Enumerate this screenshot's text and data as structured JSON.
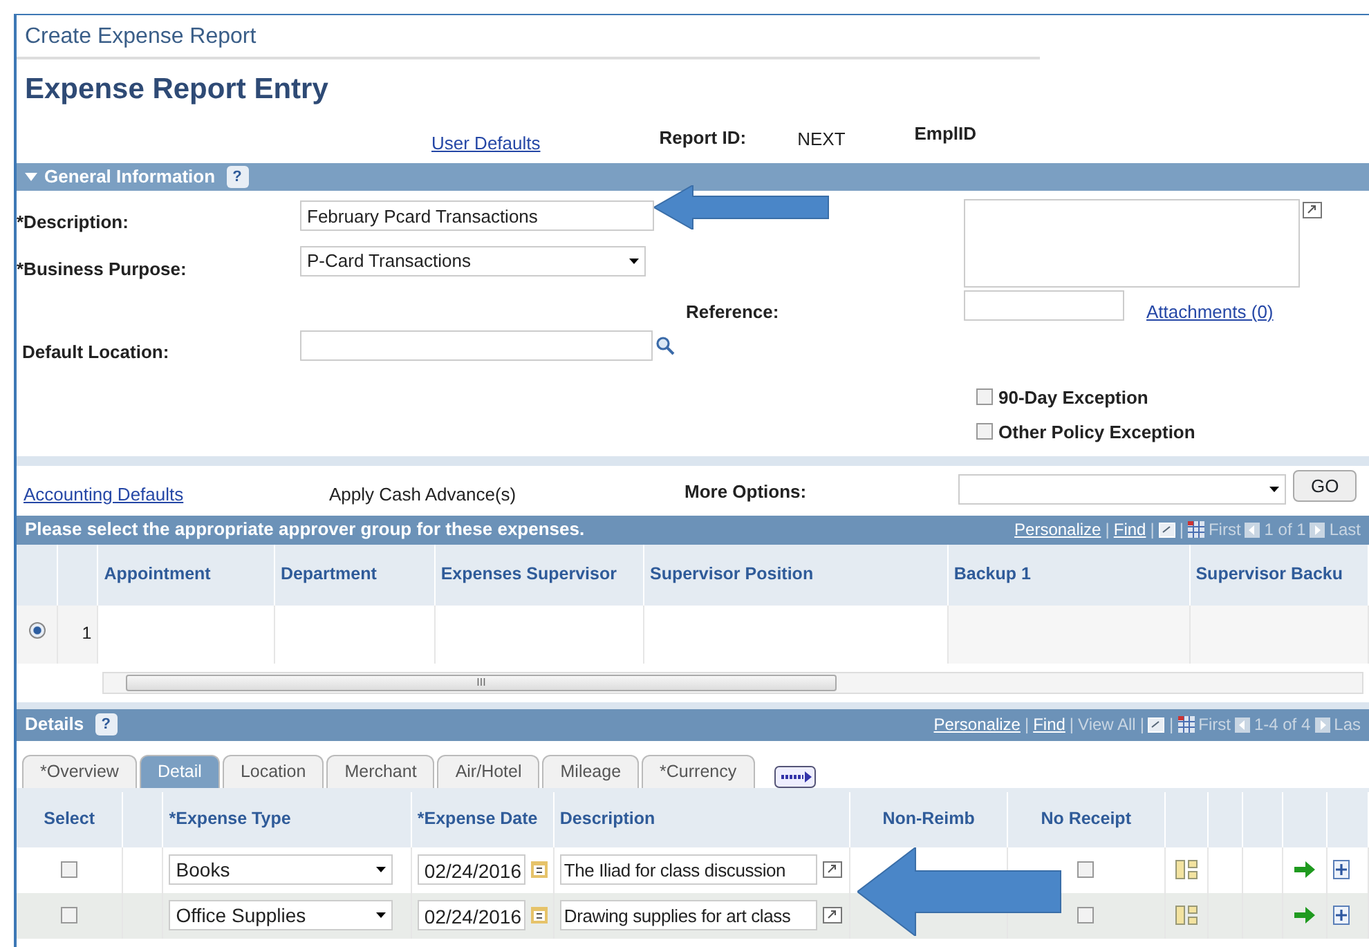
{
  "breadcrumb": "Create Expense Report",
  "title": "Expense Report Entry",
  "header": {
    "user_defaults": "User Defaults",
    "report_id_label": "Report ID:",
    "report_id": "NEXT",
    "emplid_label": "EmplID"
  },
  "general": {
    "title": "General Information",
    "help": "?",
    "expanded": true,
    "description": {
      "label": "*Description:",
      "value": "February Pcard Transactions"
    },
    "business_purpose": {
      "label": "*Business Purpose:",
      "value": "P-Card Transactions"
    },
    "reference_label": "Reference:",
    "attachments": "Attachments (0)",
    "default_location_label": "Default Location:",
    "checkboxes": [
      {
        "label": "90-Day Exception",
        "checked": false
      },
      {
        "label": "Other Policy Exception",
        "checked": false
      }
    ]
  },
  "options_bar": {
    "accounting_defaults": "Accounting Defaults",
    "apply_cash": "Apply Cash Advance(s)",
    "more_options_label": "More Options:",
    "go": "GO"
  },
  "approver_grid": {
    "title": "Please select the appropriate approver group for these expenses.",
    "nav": [
      {
        "kind": "link",
        "text": "Personalize"
      },
      {
        "kind": "sep",
        "text": "|"
      },
      {
        "kind": "link",
        "text": "Find"
      },
      {
        "kind": "sep",
        "text": "|"
      },
      {
        "kind": "zoom"
      },
      {
        "kind": "sep",
        "text": "|"
      },
      {
        "kind": "grid"
      },
      {
        "kind": "text",
        "text": "First"
      },
      {
        "kind": "prev"
      },
      {
        "kind": "count",
        "text": "1 of 1"
      },
      {
        "kind": "next"
      },
      {
        "kind": "text",
        "text": "Last"
      }
    ],
    "columns": [
      "Appointment",
      "Department",
      "Expenses Supervisor",
      "Supervisor Position",
      "Backup 1",
      "Supervisor Backu"
    ],
    "rows": [
      {
        "selected": true,
        "number": "1"
      }
    ],
    "scroll_mark": "III"
  },
  "details": {
    "title": "Details",
    "help": "?",
    "nav": [
      {
        "kind": "link",
        "text": "Personalize"
      },
      {
        "kind": "sep",
        "text": "|"
      },
      {
        "kind": "link",
        "text": "Find"
      },
      {
        "kind": "sep",
        "text": "|"
      },
      {
        "kind": "text",
        "text": "View All"
      },
      {
        "kind": "sep",
        "text": "|"
      },
      {
        "kind": "zoom"
      },
      {
        "kind": "sep",
        "text": "|"
      },
      {
        "kind": "grid"
      },
      {
        "kind": "text",
        "text": "First"
      },
      {
        "kind": "prev"
      },
      {
        "kind": "count",
        "text": "1-4 of 4"
      },
      {
        "kind": "next"
      },
      {
        "kind": "text",
        "text": "Las"
      }
    ],
    "tabs": [
      {
        "label": "*Overview",
        "selected": false
      },
      {
        "label": "Detail",
        "selected": true
      },
      {
        "label": "Location",
        "selected": false
      },
      {
        "label": "Merchant",
        "selected": false
      },
      {
        "label": "Air/Hotel",
        "selected": false
      },
      {
        "label": "Mileage",
        "selected": false
      },
      {
        "label": "*Currency",
        "selected": false
      }
    ],
    "columns": [
      "Select",
      "*Expense Type",
      "*Expense Date",
      "Description",
      "Non-Reimb",
      "No Receipt"
    ],
    "rows": [
      {
        "checked": false,
        "expense_type": "Books",
        "date": "02/24/2016",
        "description": "The Iliad for class discussion",
        "no_receipt": false
      },
      {
        "checked": false,
        "expense_type": "Office Supplies",
        "date": "02/24/2016",
        "description": "Drawing supplies for art class",
        "no_receipt": false
      }
    ]
  }
}
